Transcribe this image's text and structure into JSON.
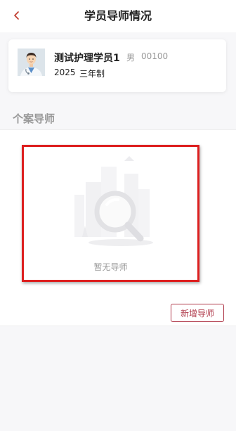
{
  "header": {
    "title": "学员导师情况",
    "back_icon": "chevron-left-icon",
    "accent_color": "#b03a4b"
  },
  "student": {
    "name": "测试护理学员1",
    "gender": "男",
    "id": "00100",
    "year": "2025",
    "program": "三年制",
    "avatar_icon": "doctor-avatar"
  },
  "section": {
    "title": "个案导师"
  },
  "empty_state": {
    "icon": "magnifier-empty-illustration",
    "text": "暂无导师",
    "highlight_color": "#dd1f1f"
  },
  "actions": {
    "add_mentor_label": "新增导师"
  }
}
